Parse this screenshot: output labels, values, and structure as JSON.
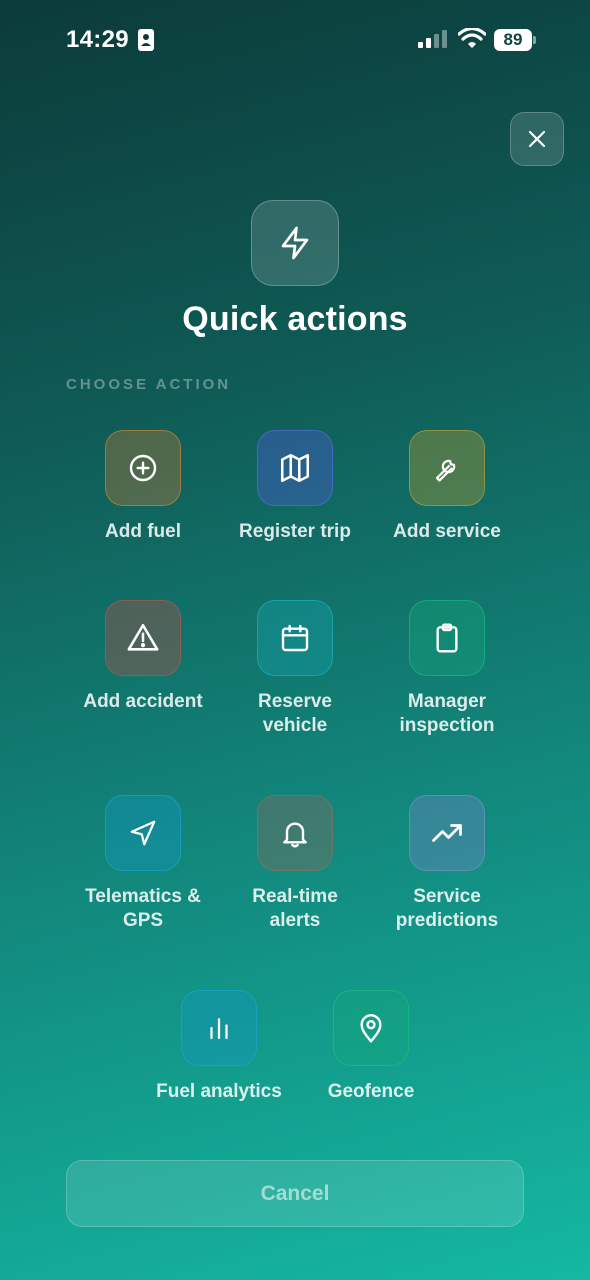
{
  "status_bar": {
    "time": "14:29",
    "battery": "89"
  },
  "header": {
    "title": "Quick actions",
    "section_label": "CHOOSE ACTION",
    "icon": "lightning-icon"
  },
  "actions": [
    {
      "label": "Add fuel",
      "icon": "plus-circle-icon",
      "color": "#c8783c"
    },
    {
      "label": "Register trip",
      "icon": "map-icon",
      "color": "#5a6ee6"
    },
    {
      "label": "Add service",
      "icon": "wrench-icon",
      "color": "#c8aa3c"
    },
    {
      "label": "Add accident",
      "icon": "warning-triangle-icon",
      "color": "#c85a50"
    },
    {
      "label": "Reserve\nvehicle",
      "icon": "calendar-icon",
      "color": "#1ebec8"
    },
    {
      "label": "Manager\ninspection",
      "icon": "clipboard-icon",
      "color": "#1ec88c"
    },
    {
      "label": "Telematics &\nGPS",
      "icon": "navigation-arrow-icon",
      "color": "#1eaadc"
    },
    {
      "label": "Real-time\nalerts",
      "icon": "bell-icon",
      "color": "#aa6e64"
    },
    {
      "label": "Service\npredictions",
      "icon": "trending-up-icon",
      "color": "#8296d2"
    },
    {
      "label": "Fuel analytics",
      "icon": "bar-chart-icon",
      "color": "#1eaadc"
    },
    {
      "label": "Geofence",
      "icon": "map-pin-icon",
      "color": "#1ec88c"
    }
  ],
  "footer": {
    "cancel_label": "Cancel"
  },
  "colors": {
    "background_top": "#0b3b3a",
    "background_bottom": "#14b8a2"
  }
}
